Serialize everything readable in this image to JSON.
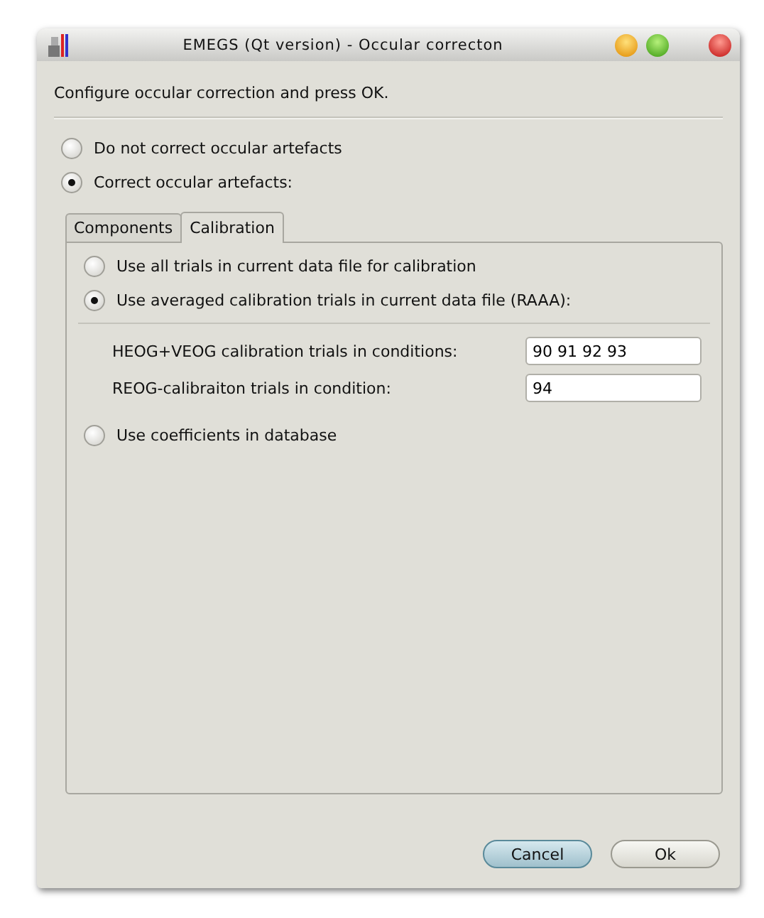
{
  "window": {
    "title": "EMEGS (Qt version) - Occular correcton"
  },
  "instruction": "Configure occular correction and press OK.",
  "modes": [
    {
      "label": "Do not correct occular artefacts",
      "selected": false
    },
    {
      "label": "Correct occular artefacts:",
      "selected": true
    }
  ],
  "tabs": [
    {
      "label": "Components",
      "selected": false
    },
    {
      "label": "Calibration",
      "selected": true
    }
  ],
  "calibration": {
    "options": [
      {
        "label": "Use all trials in current data file for calibration",
        "selected": false
      },
      {
        "label": "Use averaged calibration trials in current data file (RAAA):",
        "selected": true,
        "fields": [
          {
            "label": "HEOG+VEOG calibration trials in conditions:",
            "value": "90 91 92 93"
          },
          {
            "label": "REOG-calibraiton trials in condition:",
            "value": "94"
          }
        ]
      },
      {
        "label": "Use coefficients in database",
        "selected": false
      }
    ]
  },
  "buttons": [
    {
      "label": "Cancel",
      "default": true
    },
    {
      "label": "Ok",
      "default": false
    }
  ]
}
